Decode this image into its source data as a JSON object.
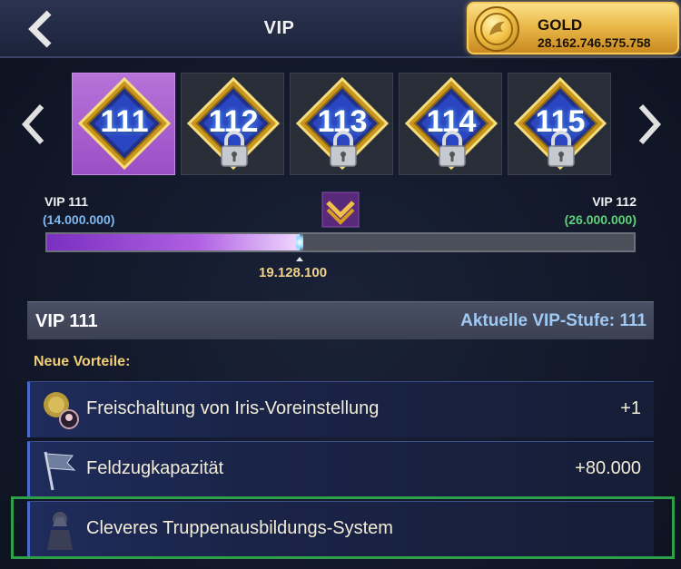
{
  "header": {
    "title": "VIP",
    "gold_label": "GOLD",
    "gold_value": "28.162.746.575.758"
  },
  "levels": [
    {
      "number": "111",
      "locked": false,
      "selected": true
    },
    {
      "number": "112",
      "locked": true,
      "selected": false
    },
    {
      "number": "113",
      "locked": true,
      "selected": false
    },
    {
      "number": "114",
      "locked": true,
      "selected": false
    },
    {
      "number": "115",
      "locked": true,
      "selected": false
    }
  ],
  "progress": {
    "current_level": "VIP 111",
    "current_threshold": "(14.000.000)",
    "next_level": "VIP 112",
    "next_threshold": "(26.000.000)",
    "current_points": "19.128.100",
    "fraction": 0.43
  },
  "section": {
    "title": "VIP 111",
    "status": "Aktuelle VIP-Stufe: 111",
    "benefits_heading": "Neue Vorteile:"
  },
  "benefits": [
    {
      "label": "Freischaltung von Iris-Voreinstellung",
      "value": "+1",
      "icon": "iris-preset-icon"
    },
    {
      "label": "Feldzugkapazität",
      "value": "+80.000",
      "icon": "campaign-flag-icon"
    },
    {
      "label": "Cleveres Truppenausbildungs-System",
      "value": "",
      "icon": "troop-training-icon"
    }
  ],
  "colors": {
    "accent_purple": "#9b4fc5",
    "highlight_green": "#2fa04a",
    "gold": "#eab94a"
  }
}
